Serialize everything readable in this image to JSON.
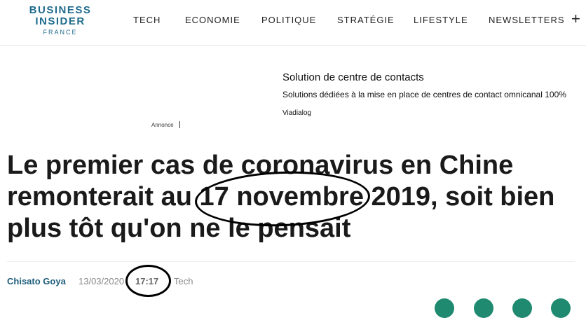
{
  "brand": {
    "line1": "BUSINESS",
    "line2": "INSIDER",
    "line3": "FRANCE",
    "color": "#1f6b8c"
  },
  "nav": {
    "items": [
      "TECH",
      "ECONOMIE",
      "POLITIQUE",
      "STRATÉGIE",
      "LIFESTYLE",
      "NEWSLETTERS"
    ],
    "more_icon": "plus-icon"
  },
  "ad": {
    "title": "Solution de centre de contacts",
    "description": "Solutions dédiées à la mise en place de centres de contact omnicanal 100%",
    "source": "Viadialog",
    "label": "Annonce"
  },
  "article": {
    "headline_lines": [
      "Le premier cas de coronavirus en Chine",
      "remonterait au 17 novembre 2019, soit bien",
      "plus tôt qu'on ne le pensait"
    ],
    "author": "Chisato Goya",
    "date": "13/03/2020",
    "time": "17:17",
    "category": "Tech"
  },
  "share_colors": [
    "#1f8a70",
    "#1f8a70",
    "#1f8a70",
    "#1f8a70"
  ]
}
